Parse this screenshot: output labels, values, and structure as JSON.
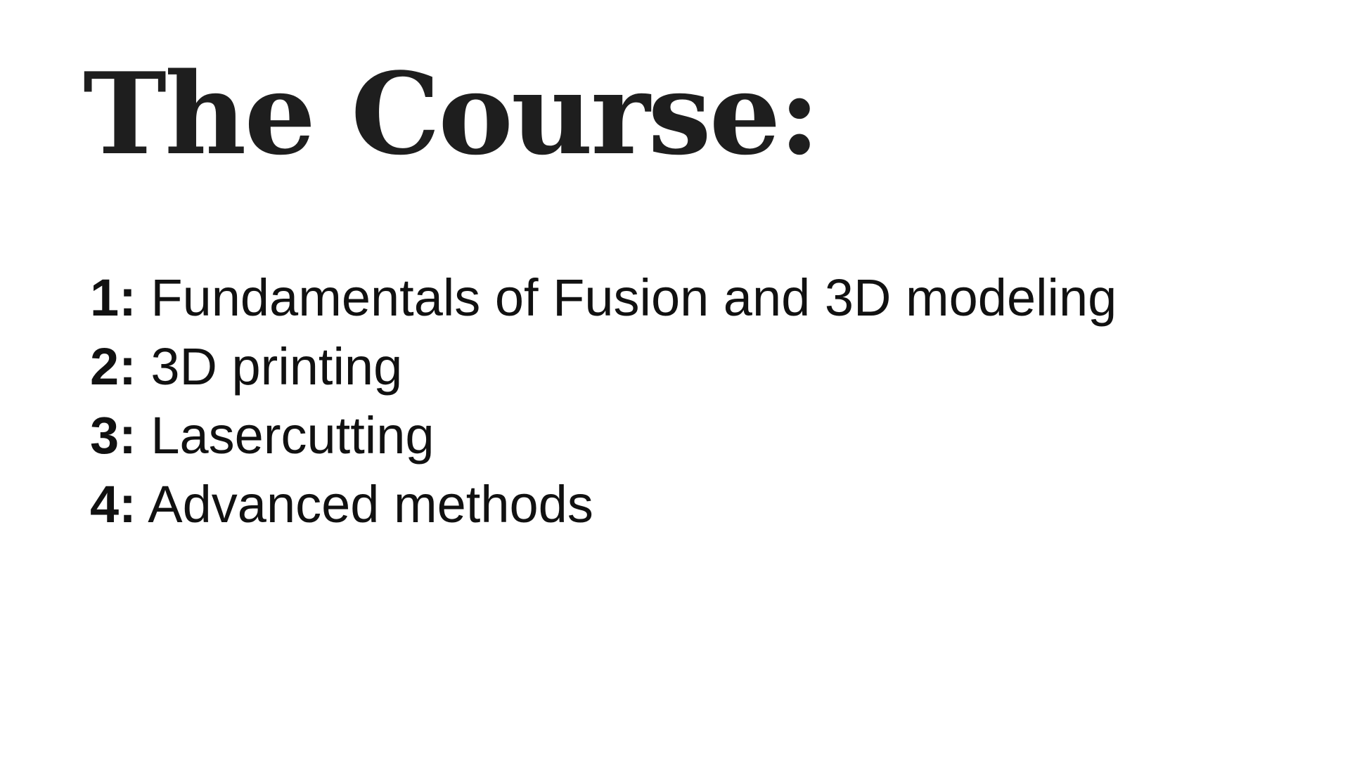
{
  "slide": {
    "title": "The Course:",
    "items": [
      {
        "number": "1:",
        "label": "Fundamentals of Fusion and 3D modeling"
      },
      {
        "number": "2:",
        "label": "3D printing"
      },
      {
        "number": "3:",
        "label": "Lasercutting"
      },
      {
        "number": "4:",
        "label": "Advanced methods"
      }
    ]
  },
  "colors": {
    "background": "#ffffff",
    "title_text": "#1e1e1e",
    "body_text": "#111111"
  }
}
